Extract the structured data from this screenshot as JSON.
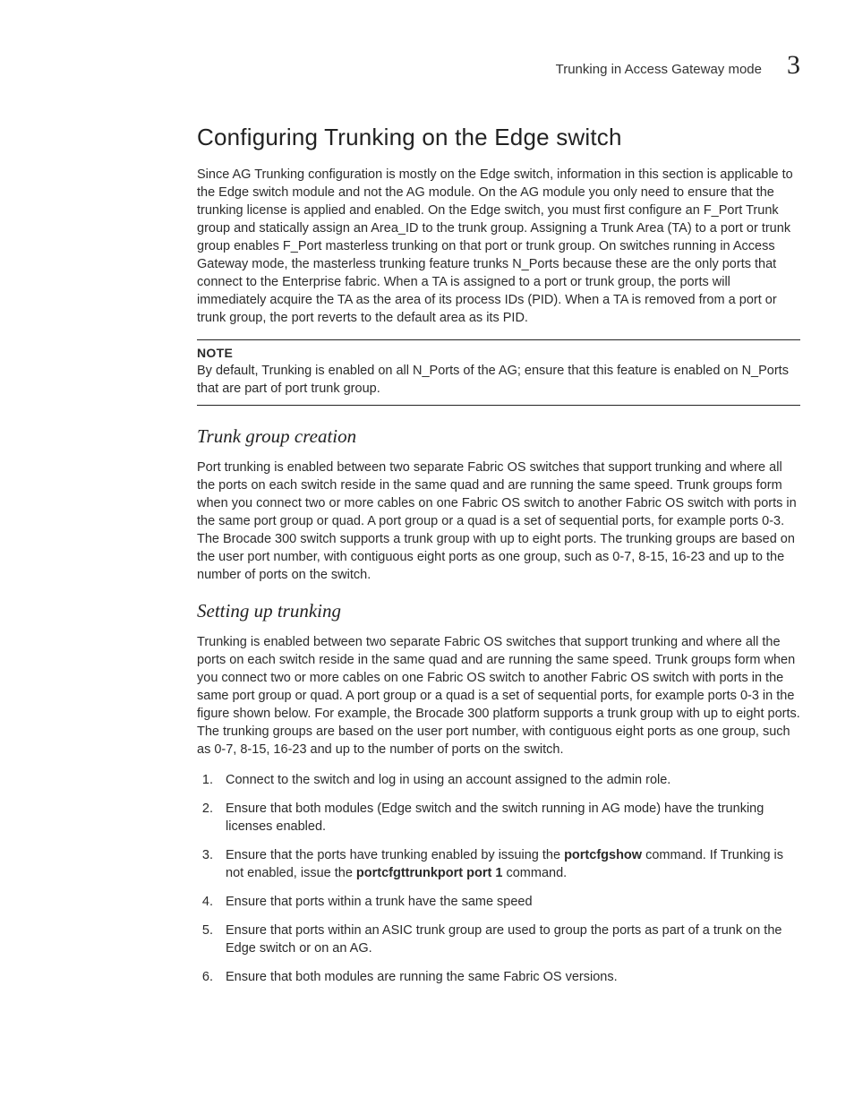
{
  "header": {
    "running_title": "Trunking in Access Gateway mode",
    "chapter_number": "3"
  },
  "section": {
    "title": "Configuring Trunking on the Edge switch",
    "intro": "Since AG Trunking configuration is mostly on the Edge switch, information in this section is applicable to the Edge switch module and not the AG module. On the AG module you only need to ensure that the trunking license is applied and enabled. On the Edge switch, you must first configure an F_Port Trunk group and statically assign an Area_ID to the trunk group. Assigning a Trunk Area (TA) to a port or trunk group enables F_Port masterless trunking on that port or trunk group. On switches running in Access Gateway mode, the masterless trunking feature trunks N_Ports because these are the only ports that connect to the Enterprise fabric. When a TA is assigned to a port or trunk group, the ports will immediately acquire the TA as the area of its process IDs (PID). When a TA is removed from a port or trunk group, the port reverts to the default area as its PID."
  },
  "note": {
    "label": "NOTE",
    "body": "By default, Trunking is enabled on all N_Ports of the AG; ensure that this feature is enabled on N_Ports that are part of port trunk group."
  },
  "sub1": {
    "title": "Trunk group creation",
    "body": "Port trunking is enabled between two separate Fabric OS switches that support trunking and where all the ports on each switch reside in the same quad and are running the same speed. Trunk groups form when you connect two or more cables on one Fabric OS switch to another Fabric OS switch with ports in the same port group or quad. A port group or a quad is a set of sequential ports, for example ports 0-3. The Brocade 300 switch supports a trunk group with up to eight ports. The trunking groups are based on the user port number, with contiguous eight ports as one group, such as 0-7, 8-15, 16-23 and up to the number of ports on the switch."
  },
  "sub2": {
    "title": "Setting up trunking",
    "body": "Trunking is enabled between two separate Fabric OS switches that support trunking and where all the ports on each switch reside in the same quad and are running the same speed. Trunk groups form when you connect two or more cables on one Fabric OS switch to another Fabric OS switch with ports in the same port group or quad. A port group or a quad is a set of sequential ports, for example ports 0-3 in the figure shown below. For example, the Brocade 300 platform supports a trunk group with up to eight ports. The trunking groups are based on the user port number, with contiguous eight ports as one group, such as 0-7, 8-15, 16-23 and up to the number of ports on the switch.",
    "steps": {
      "s1": "Connect to the switch and log in using an account assigned to the admin role.",
      "s2": "Ensure that both modules (Edge switch and the switch running in AG mode) have the trunking licenses enabled.",
      "s3a": "Ensure that the ports have trunking enabled by issuing the ",
      "s3cmd1": "portcfgshow",
      "s3b": " command. If Trunking is not enabled, issue the ",
      "s3cmd2": "portcfgttrunkport port 1",
      "s3c": " command.",
      "s4": "Ensure that ports within a trunk have the same speed",
      "s5": "Ensure that ports within an ASIC trunk group are used to group the ports as part of a trunk on the Edge switch or on an AG.",
      "s6": "Ensure that both modules are running the same Fabric OS versions."
    }
  }
}
